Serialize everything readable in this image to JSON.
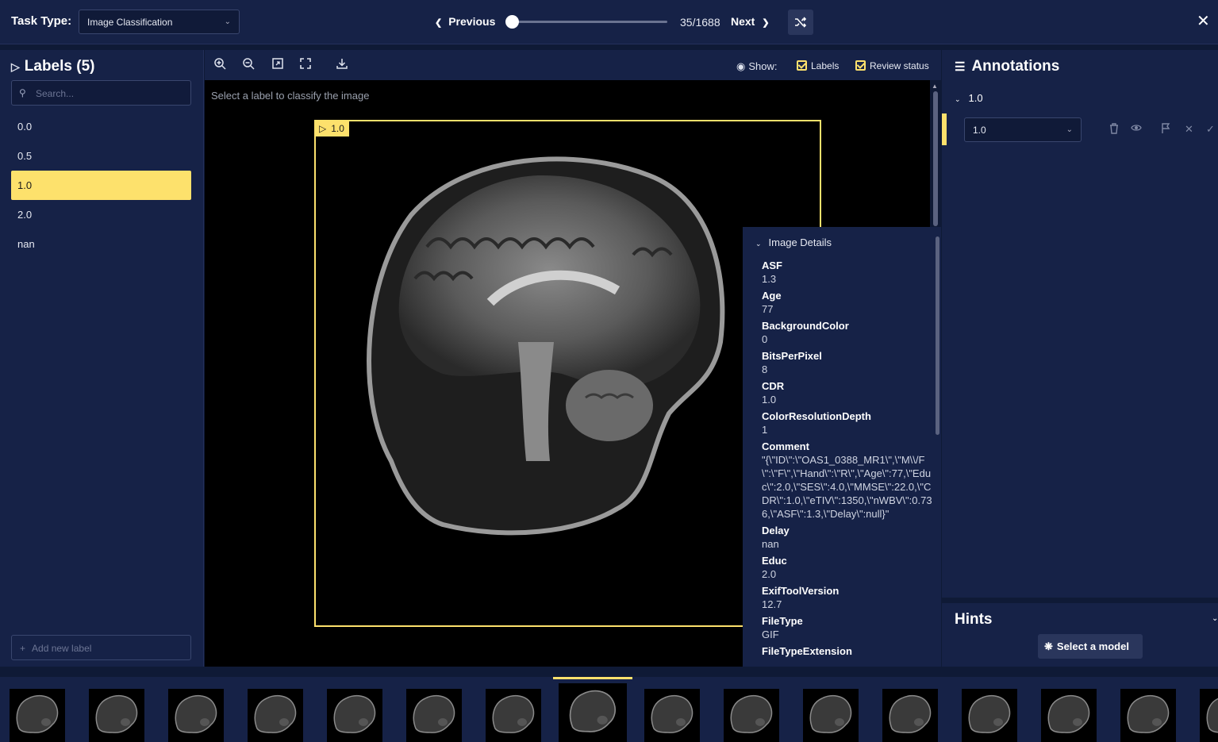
{
  "topbar": {
    "task_type_label": "Task Type:",
    "task_type_value": "Image Classification",
    "prev_label": "Previous",
    "next_label": "Next",
    "counter": "35/1688",
    "progress": 0.02,
    "shuffle_icon": "shuffle-icon",
    "close_icon": "close-icon"
  },
  "labels_panel": {
    "title": "Labels (5)",
    "search_placeholder": "Search...",
    "items": [
      {
        "label": "0.0",
        "active": false
      },
      {
        "label": "0.5",
        "active": false
      },
      {
        "label": "1.0",
        "active": true
      },
      {
        "label": "2.0",
        "active": false
      },
      {
        "label": "nan",
        "active": false
      }
    ],
    "add_label": "Add new label"
  },
  "toolbar": {
    "tools": [
      "zoom-in-icon",
      "zoom-out-icon",
      "fit-icon",
      "fullscreen-icon",
      "download-icon"
    ],
    "show_label": "Show:",
    "labels_checkbox": "Labels",
    "review_checkbox": "Review status"
  },
  "viewer": {
    "hint": "Select a label to classify the image",
    "bbox_tag": "1.0"
  },
  "image_details": {
    "title": "Image Details",
    "fields": [
      {
        "key": "ASF",
        "value": "1.3"
      },
      {
        "key": "Age",
        "value": "77"
      },
      {
        "key": "BackgroundColor",
        "value": "0"
      },
      {
        "key": "BitsPerPixel",
        "value": "8"
      },
      {
        "key": "CDR",
        "value": "1.0"
      },
      {
        "key": "ColorResolutionDepth",
        "value": "1"
      },
      {
        "key": "Comment",
        "value": "\"{\\\"ID\\\":\\\"OAS1_0388_MR1\\\",\\\"M\\\\/F\\\":\\\"F\\\",\\\"Hand\\\":\\\"R\\\",\\\"Age\\\":77,\\\"Educ\\\":2.0,\\\"SES\\\":4.0,\\\"MMSE\\\":22.0,\\\"CDR\\\":1.0,\\\"eTIV\\\":1350,\\\"nWBV\\\":0.736,\\\"ASF\\\":1.3,\\\"Delay\\\":null}\""
      },
      {
        "key": "Delay",
        "value": "nan"
      },
      {
        "key": "Educ",
        "value": "2.0"
      },
      {
        "key": "ExifToolVersion",
        "value": "12.7"
      },
      {
        "key": "FileType",
        "value": "GIF"
      },
      {
        "key": "FileTypeExtension",
        "value": ""
      }
    ]
  },
  "annotations": {
    "title": "Annotations",
    "group": "1.0",
    "selected": "1.0"
  },
  "hints": {
    "title": "Hints",
    "button": "Select a model"
  },
  "colors": {
    "accent": "#fde16c",
    "panel": "#162247",
    "background": "#0f1a36"
  }
}
